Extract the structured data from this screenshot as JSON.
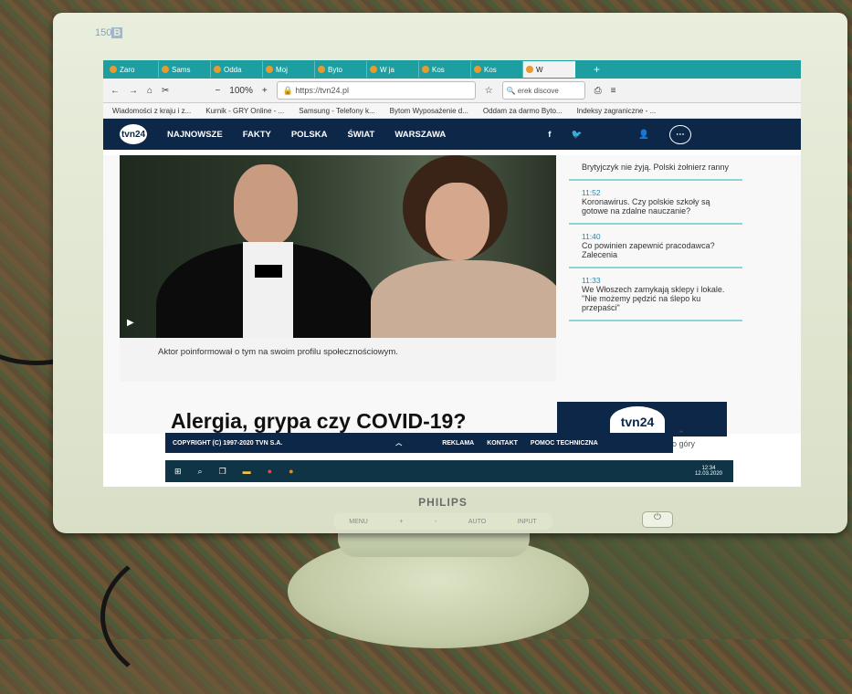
{
  "monitor": {
    "model": "150",
    "model_suffix": "B",
    "brand": "PHILIPS",
    "buttons": [
      "MENU",
      "+",
      "-",
      "AUTO",
      "INPUT"
    ],
    "power_symbol": "⏻"
  },
  "browser": {
    "tabs": [
      "Zaro",
      "Sams",
      "Odda",
      "Moj",
      "Byto",
      "W ja",
      "Kos",
      "Kos",
      "W"
    ],
    "zoom": "100%",
    "url": "https://tvn24.pl",
    "search_value": "erek discove",
    "bookmarks": [
      "Wiadomości z kraju i z...",
      "Kurnik - GRY Online - ...",
      "Samsung - Telefony k...",
      "Bytom Wyposażenie d...",
      "Oddam za darmo Byto...",
      "Indeksy zagraniczne - ..."
    ]
  },
  "site": {
    "logo": "tvn24",
    "nav": [
      "NAJNOWSZE",
      "FAKTY",
      "POLSKA",
      "ŚWIAT",
      "WARSZAWA"
    ],
    "photo_caption": "Aktor poinformował o tym na swoim profilu społecznościowym.",
    "headline": "Alergia, grypa czy COVID-19?",
    "news": [
      {
        "time": "",
        "text": "Brytyjczyk nie żyją. Polski żołnierz ranny"
      },
      {
        "time": "11:52",
        "text": "Koronawirus. Czy polskie szkoły są gotowe na zdalne nauczanie?"
      },
      {
        "time": "11:40",
        "text": "Co powinien zapewnić pracodawca? Zalecenia"
      },
      {
        "time": "11:33",
        "text": "We Włoszech zamykają sklepy i lokale. \"Nie możemy pędzić na ślepo ku przepaści\""
      }
    ],
    "up_label": "do góry",
    "footer": {
      "copyright": "COPYRIGHT (C) 1997-2020 TVN S.A.",
      "links": [
        "REKLAMA",
        "KONTAKT",
        "POMOC TECHNICZNA"
      ]
    }
  },
  "taskbar": {
    "time": "12:34",
    "date": "12.03.2020"
  }
}
